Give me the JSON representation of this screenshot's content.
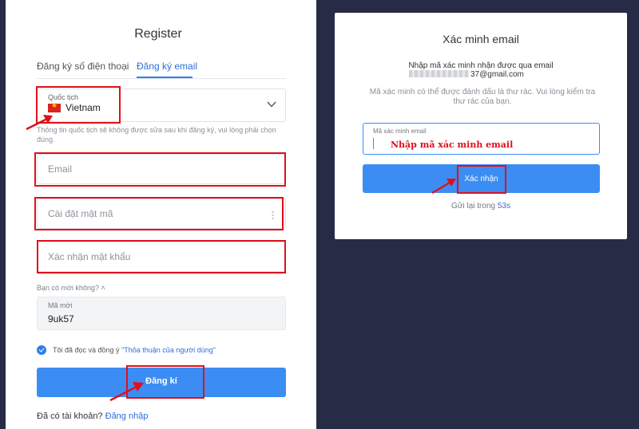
{
  "register": {
    "title": "Register",
    "tabs": [
      {
        "label": "Đăng ký số điện thoại",
        "active": false
      },
      {
        "label": "Đăng ký email",
        "active": true
      }
    ],
    "nationality": {
      "label": "Quốc tịch",
      "value": "Vietnam",
      "flag": "vietnam-flag-icon"
    },
    "nationality_note": "Thông tin quốc tịch sẽ không được sửa sau khi đăng ký, vui lòng phải chọn đúng.",
    "email_placeholder": "Email",
    "password_placeholder": "Cài đặt mật mã",
    "confirm_placeholder": "Xác nhận mật khẩu",
    "invite_toggle": "Bạn có mời không?",
    "invite_label": "Mã mời",
    "invite_value": "9uk57",
    "agree_text": "Tôi đã đọc và đồng ý",
    "agree_link": "\"Thỏa thuận của người dùng\"",
    "submit_label": "Đăng kí",
    "login_prompt": "Đã có tài khoản?",
    "login_link": "Đăng nhập"
  },
  "verify": {
    "title": "Xác minh email",
    "line1": "Nhập mã xác minh nhận được qua email",
    "email_suffix": "37@gmail.com",
    "note": "Mã xác minh có thể được đánh dấu là thư rác. Vui lòng kiểm tra thư rác của bạn.",
    "field_label": "Mã xác minh email",
    "hint": "Nhập mã xác minh email",
    "confirm_label": "Xác nhận",
    "resend_text": "Gửi lại trong",
    "timer": "53s"
  },
  "colors": {
    "accent": "#3c8df3",
    "link": "#2f6dd8",
    "annotation": "#e0101a",
    "background": "#272b45"
  }
}
